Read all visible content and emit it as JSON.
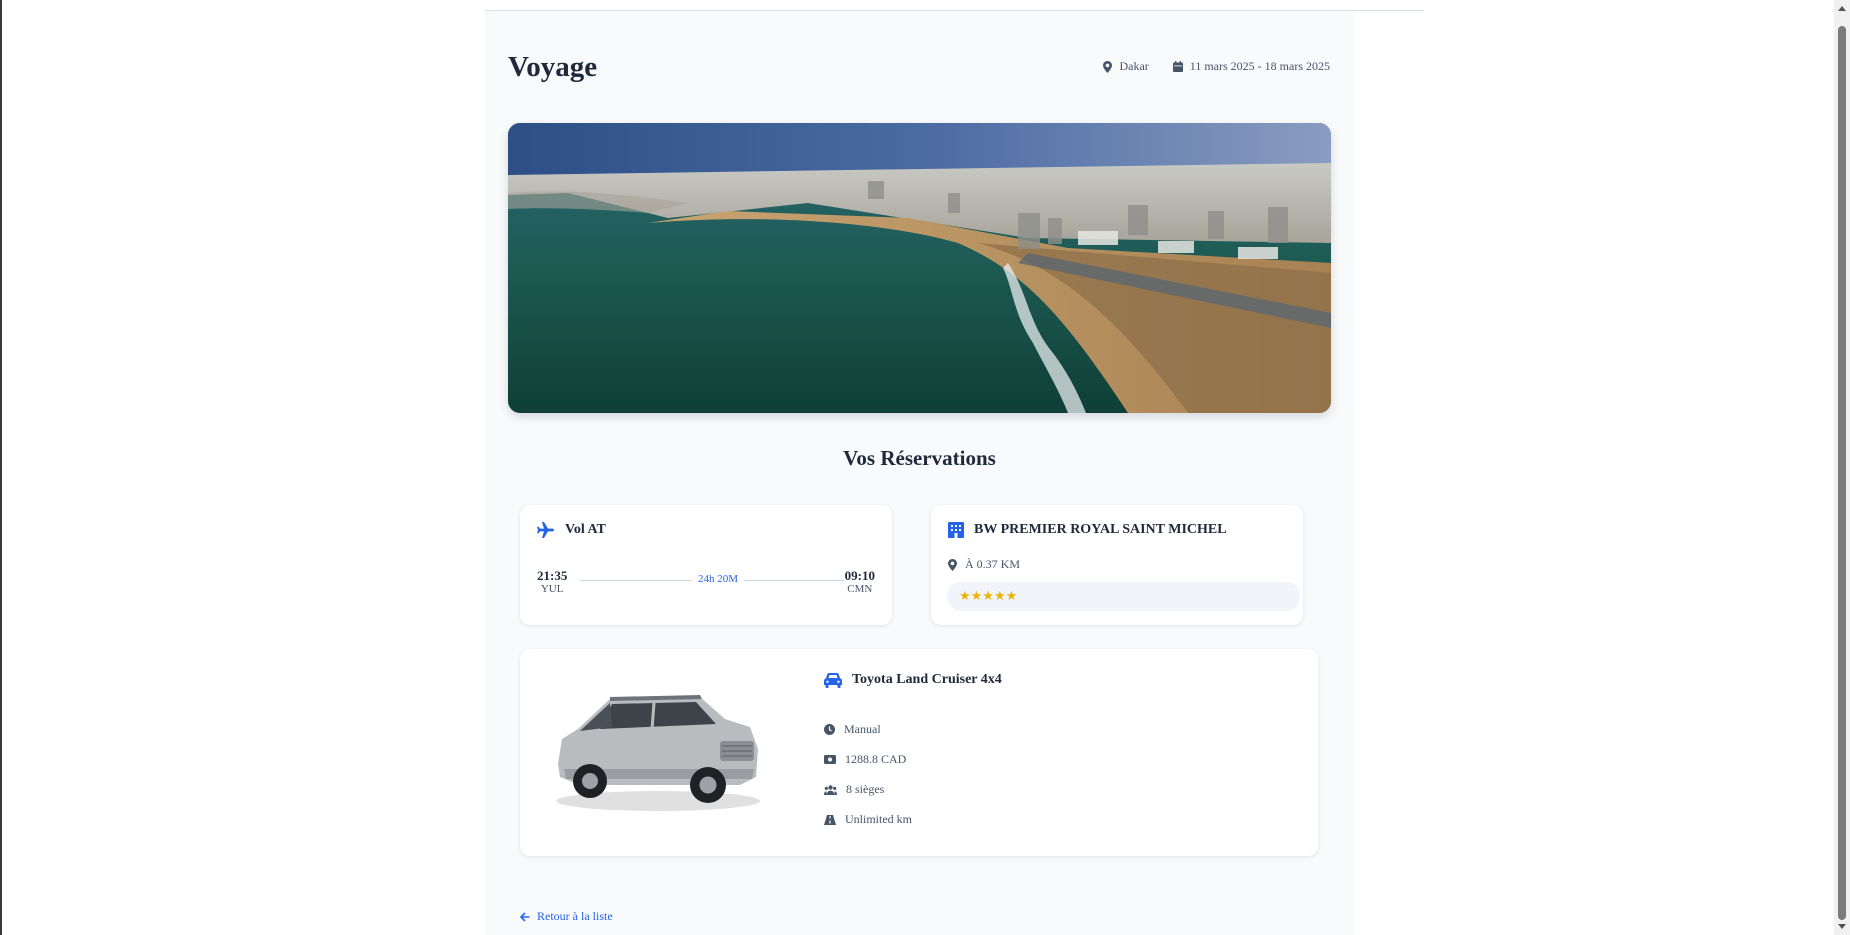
{
  "trip": {
    "title": "Voyage",
    "location": "Dakar",
    "dates": "11 mars 2025 - 18 mars 2025"
  },
  "section_title": "Vos Réservations",
  "flight": {
    "name": "Vol AT",
    "departure_time": "21:35",
    "departure_code": "YUL",
    "duration": "24h 20M",
    "arrival_time": "09:10",
    "arrival_code": "CMN"
  },
  "hotel": {
    "name": "BW PREMIER ROYAL SAINT MICHEL",
    "distance": "À 0.37 KM",
    "stars": "★★★★★",
    "rating": 5
  },
  "car": {
    "name": "Toyota Land Cruiser 4x4",
    "transmission": "Manual",
    "price": "1288.8 CAD",
    "seats": "8 sièges",
    "mileage": "Unlimited km"
  },
  "nav": {
    "back_label": "Retour à la liste"
  },
  "colors": {
    "accent": "#2563eb",
    "page_bg": "#f8fafc",
    "card_bg": "#ffffff",
    "star": "#eab308"
  },
  "icons": {
    "location": "map-pin-icon",
    "calendar": "calendar-icon",
    "flight": "plane-icon",
    "hotel": "building-icon",
    "car": "car-icon",
    "transmission": "clock-icon",
    "price": "money-icon",
    "seats": "users-icon",
    "mileage": "road-icon",
    "back": "arrow-left-icon"
  }
}
